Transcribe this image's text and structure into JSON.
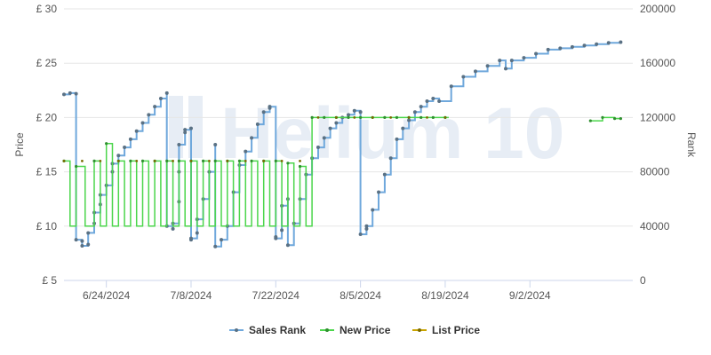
{
  "chart_data": {
    "type": "line",
    "xlabel": "",
    "ylabel": "Price",
    "y2label": "Rank",
    "y_ticks": [
      "£ 5",
      "£ 10",
      "£ 15",
      "£ 20",
      "£ 25",
      "£ 30"
    ],
    "ylim": [
      5,
      30
    ],
    "y2_ticks": [
      "0",
      "40000",
      "80000",
      "120000",
      "160000",
      "200000"
    ],
    "y2lim": [
      0,
      200000
    ],
    "x_ticks": [
      "2024-06-24",
      "2024-07-08",
      "2024-07-22",
      "2024-08-05",
      "2024-08-19",
      "2024-09-02"
    ],
    "x_tick_labels": [
      "6/24/2024",
      "7/8/2024",
      "7/22/2024",
      "8/5/2024",
      "8/19/2024",
      "9/2/2024"
    ],
    "xlim": [
      "2024-06-17",
      "2024-09-19"
    ],
    "grid": true,
    "legend_position": "bottom",
    "watermark": "Helium 10",
    "series": [
      {
        "name": "Sales Rank",
        "axis": "right",
        "color": "#6fa8dc",
        "marker_color": "#5a7184",
        "x": [
          "2024-06-17",
          "2024-06-18",
          "2024-06-19",
          "2024-06-19",
          "2024-06-20",
          "2024-06-20",
          "2024-06-21",
          "2024-06-21",
          "2024-06-22",
          "2024-06-22",
          "2024-06-23",
          "2024-06-23",
          "2024-06-24",
          "2024-06-25",
          "2024-06-25",
          "2024-06-26",
          "2024-06-27",
          "2024-06-28",
          "2024-06-29",
          "2024-06-30",
          "2024-07-01",
          "2024-07-02",
          "2024-07-03",
          "2024-07-04",
          "2024-07-04",
          "2024-07-05",
          "2024-07-05",
          "2024-07-06",
          "2024-07-06",
          "2024-07-06",
          "2024-07-07",
          "2024-07-07",
          "2024-07-08",
          "2024-07-08",
          "2024-07-08",
          "2024-07-09",
          "2024-07-09",
          "2024-07-10",
          "2024-07-11",
          "2024-07-12",
          "2024-07-12",
          "2024-07-13",
          "2024-07-14",
          "2024-07-15",
          "2024-07-16",
          "2024-07-17",
          "2024-07-18",
          "2024-07-19",
          "2024-07-20",
          "2024-07-21",
          "2024-07-21",
          "2024-07-22",
          "2024-07-22",
          "2024-07-23",
          "2024-07-23",
          "2024-07-24",
          "2024-07-24",
          "2024-07-25",
          "2024-07-26",
          "2024-07-27",
          "2024-07-28",
          "2024-07-29",
          "2024-07-30",
          "2024-07-31",
          "2024-08-01",
          "2024-08-02",
          "2024-08-03",
          "2024-08-04",
          "2024-08-05",
          "2024-08-05",
          "2024-08-06",
          "2024-08-06",
          "2024-08-07",
          "2024-08-08",
          "2024-08-09",
          "2024-08-10",
          "2024-08-11",
          "2024-08-12",
          "2024-08-13",
          "2024-08-14",
          "2024-08-15",
          "2024-08-16",
          "2024-08-17",
          "2024-08-18",
          "2024-08-20",
          "2024-08-22",
          "2024-08-24",
          "2024-08-26",
          "2024-08-28",
          "2024-08-29",
          "2024-08-30",
          "2024-09-01",
          "2024-09-03",
          "2024-09-05",
          "2024-09-07",
          "2024-09-09",
          "2024-09-11",
          "2024-09-13",
          "2024-09-15",
          "2024-09-17"
        ],
        "values": [
          137000,
          138000,
          137500,
          30000,
          29000,
          25500,
          26500,
          35000,
          42000,
          50000,
          56000,
          63000,
          70000,
          80000,
          86000,
          92000,
          98000,
          104000,
          110000,
          116000,
          122000,
          128000,
          134000,
          138000,
          40000,
          38000,
          42000,
          58000,
          80000,
          100000,
          109000,
          111000,
          112000,
          30000,
          31000,
          35000,
          45000,
          60000,
          80000,
          100000,
          25000,
          30000,
          40000,
          65000,
          85000,
          95000,
          105000,
          115000,
          124000,
          127000,
          128000,
          32000,
          31000,
          37000,
          55000,
          60000,
          26000,
          42000,
          60000,
          78000,
          90000,
          98000,
          105000,
          112000,
          116000,
          120000,
          122000,
          125000,
          124000,
          34000,
          38000,
          40000,
          52000,
          65000,
          78000,
          90000,
          104000,
          112000,
          118000,
          124000,
          128000,
          132000,
          134000,
          132000,
          143000,
          150000,
          154000,
          158000,
          162000,
          156000,
          162000,
          164000,
          167000,
          170000,
          171000,
          172000,
          173000,
          174000,
          175000,
          175500
        ]
      },
      {
        "name": "New Price",
        "axis": "left",
        "color": "#4cd64c",
        "marker_color": "#2f8f2f",
        "note": "price alternates between the listed value and £10",
        "x": [
          "2024-06-17",
          "2024-06-19",
          "2024-06-22",
          "2024-06-24",
          "2024-06-26",
          "2024-06-28",
          "2024-06-30",
          "2024-07-02",
          "2024-07-04",
          "2024-07-06",
          "2024-07-08",
          "2024-07-10",
          "2024-07-12",
          "2024-07-14",
          "2024-07-16",
          "2024-07-18",
          "2024-07-20",
          "2024-07-22",
          "2024-07-24",
          "2024-07-26",
          "2024-07-28",
          "2024-07-30",
          "2024-08-01",
          "2024-08-03",
          "2024-08-05",
          "2024-08-07",
          "2024-08-09",
          "2024-08-11",
          "2024-08-13",
          "2024-08-15",
          "2024-08-17",
          "2024-08-19",
          "2024-09-12",
          "2024-09-14",
          "2024-09-16",
          "2024-09-17"
        ],
        "values": [
          16,
          15.5,
          16,
          17.6,
          16,
          16,
          16,
          16,
          16,
          16,
          16,
          16,
          16,
          16,
          16,
          16,
          16,
          16,
          15.8,
          15.5,
          20,
          20,
          20,
          20,
          20,
          20,
          20,
          20,
          20,
          20,
          20,
          20,
          19.7,
          20,
          19.9,
          19.9
        ]
      },
      {
        "name": "List Price",
        "axis": "left",
        "color": "#c9a400",
        "marker_color": "#7a6a00",
        "note": "markers only along the price line",
        "x": [
          "2024-06-17",
          "2024-06-20",
          "2024-06-23",
          "2024-06-26",
          "2024-06-29",
          "2024-07-02",
          "2024-07-05",
          "2024-07-08",
          "2024-07-11",
          "2024-07-14",
          "2024-07-17",
          "2024-07-20",
          "2024-07-23",
          "2024-07-26",
          "2024-07-29",
          "2024-08-01",
          "2024-08-04",
          "2024-08-07",
          "2024-08-10",
          "2024-08-13",
          "2024-08-16",
          "2024-08-19"
        ],
        "values": [
          16,
          16,
          16,
          16,
          16,
          16,
          16,
          16,
          16,
          16,
          16,
          16,
          16,
          16,
          20,
          20,
          20,
          20,
          20,
          20,
          20,
          20
        ]
      }
    ]
  }
}
